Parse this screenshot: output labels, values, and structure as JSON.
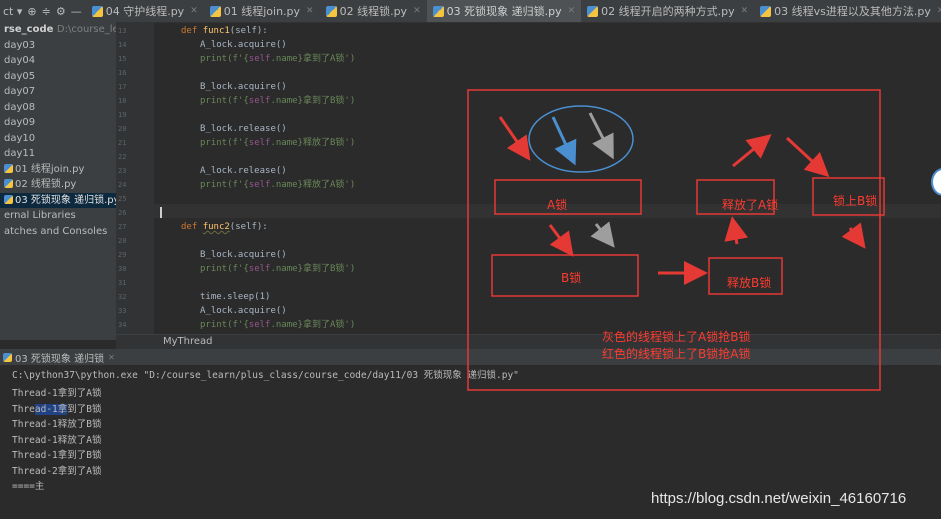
{
  "tabbar": {
    "project_switcher": "ct ▾",
    "tabs": [
      {
        "label": "04 守护线程.py",
        "active": false
      },
      {
        "label": "01 线程join.py",
        "active": false
      },
      {
        "label": "02 线程锁.py",
        "active": false
      },
      {
        "label": "03 死锁现象 递归锁.py",
        "active": true
      },
      {
        "label": "02 线程开启的两种方式.py",
        "active": false
      },
      {
        "label": "03 线程vs进程以及其他方法.py",
        "active": false
      }
    ]
  },
  "sidebar": {
    "root_label": "rse_code",
    "root_path": "D:\\course_lear",
    "items": [
      "day03",
      "day04",
      "day05",
      "day07",
      "day08",
      "day09",
      "day10",
      "day11"
    ],
    "files": [
      {
        "label": "01 线程join.py",
        "selected": false
      },
      {
        "label": "02 线程锁.py",
        "selected": false
      },
      {
        "label": "03 死锁现象 递归锁.py",
        "selected": true
      }
    ],
    "external": "ernal Libraries",
    "scratches": "atches and Consoles"
  },
  "editor": {
    "line_numbers": [
      "13",
      "14",
      "15",
      "16",
      "17",
      "18",
      "19",
      "20",
      "21",
      "22",
      "23",
      "24",
      "25",
      "26",
      "27",
      "28",
      "29",
      "30",
      "31",
      "32",
      "33",
      "34"
    ],
    "lines": [
      {
        "indent": 1,
        "kind": "def",
        "kw": "def ",
        "name": "func1",
        "args": "(self):"
      },
      {
        "indent": 2,
        "kind": "plain",
        "text": "A_lock.acquire()"
      },
      {
        "indent": 2,
        "kind": "print",
        "pre": "print(f'{",
        "self": "self",
        "mid": ".name}拿到了A锁')"
      },
      {
        "indent": 0,
        "kind": "blank",
        "text": ""
      },
      {
        "indent": 2,
        "kind": "plain",
        "text": "B_lock.acquire()"
      },
      {
        "indent": 2,
        "kind": "print",
        "pre": "print(f'{",
        "self": "self",
        "mid": ".name}拿到了B锁')"
      },
      {
        "indent": 0,
        "kind": "blank",
        "text": ""
      },
      {
        "indent": 2,
        "kind": "plain",
        "text": "B_lock.release()"
      },
      {
        "indent": 2,
        "kind": "print",
        "pre": "print(f'{",
        "self": "self",
        "mid": ".name}释放了B锁')"
      },
      {
        "indent": 0,
        "kind": "blank",
        "text": ""
      },
      {
        "indent": 2,
        "kind": "plain",
        "text": "A_lock.release()"
      },
      {
        "indent": 2,
        "kind": "print",
        "pre": "print(f'{",
        "self": "self",
        "mid": ".name}释放了A锁')"
      },
      {
        "indent": 0,
        "kind": "blank",
        "text": ""
      },
      {
        "indent": 0,
        "kind": "blank",
        "text": ""
      },
      {
        "indent": 1,
        "kind": "def",
        "kw": "def ",
        "name": "func2",
        "args": "(self):"
      },
      {
        "indent": 0,
        "kind": "blank",
        "text": ""
      },
      {
        "indent": 2,
        "kind": "plain",
        "text": "B_lock.acquire()"
      },
      {
        "indent": 2,
        "kind": "print",
        "pre": "print(f'{",
        "self": "self",
        "mid": ".name}拿到了B锁')"
      },
      {
        "indent": 0,
        "kind": "blank",
        "text": ""
      },
      {
        "indent": 2,
        "kind": "plain",
        "text": "time.sleep(1)"
      },
      {
        "indent": 2,
        "kind": "plain",
        "text": "A_lock.acquire()"
      },
      {
        "indent": 2,
        "kind": "print",
        "pre": "print(f'{",
        "self": "self",
        "mid": ".name}拿到了A锁')"
      }
    ]
  },
  "breadcrumb": "MyThread",
  "run_tab": "03 死锁现象 递归锁",
  "console": {
    "command": "C:\\python37\\python.exe \"D:/course_learn/plus_class/course_code/day11/03 死锁现象 递归锁.py\"",
    "output": [
      {
        "pre": "Thread-1",
        "hl": "",
        "post": "拿到了A锁"
      },
      {
        "pre": "Thre",
        "hl": "ad-1拿",
        "post": "到了B锁"
      },
      {
        "pre": "Thread-1",
        "hl": "",
        "post": "释放了B锁"
      },
      {
        "pre": "Thread-1",
        "hl": "",
        "post": "释放了A锁"
      },
      {
        "pre": "Thread-1",
        "hl": "",
        "post": "拿到了B锁"
      },
      {
        "pre": "Thread-2",
        "hl": "",
        "post": "拿到了A锁"
      },
      {
        "pre": "====",
        "hl": "",
        "post": "主"
      }
    ]
  },
  "annotation": {
    "box_a": "A锁",
    "box_b": "B锁",
    "release_a": "释放了A锁",
    "release_b": "释放B锁",
    "lock_b": "锁上B锁",
    "note_line1": "灰色的线程锁上了A锁抢B锁",
    "note_line2": "红色的线程锁上了B锁抢A锁",
    "color_red": "#e53935",
    "color_blue": "#4a8fd0",
    "color_gray": "#9e9e9e"
  },
  "watermark": "https://blog.csdn.net/weixin_46160716"
}
